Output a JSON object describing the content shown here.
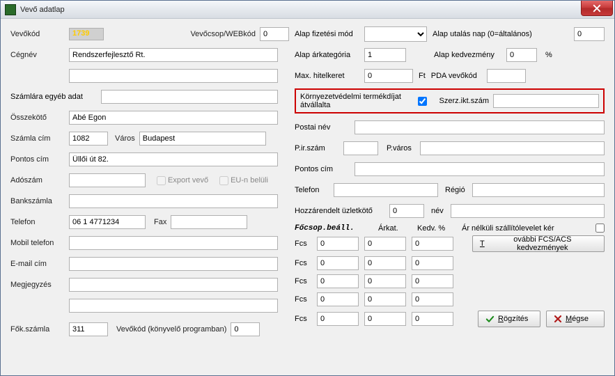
{
  "window": {
    "title": "Vevő adatlap"
  },
  "left": {
    "vevokod_label": "Vevőkód",
    "vevokod_value": "1739",
    "vevocsop_label": "Vevőcsop/WEBkód",
    "vevocsop_value": "0",
    "cegnev_label": "Cégnév",
    "cegnev_value": "Rendszerfejlesztő Rt.",
    "cegnev2_value": "",
    "szamla_egyeb_label": "Számlára egyéb adat",
    "szamla_egyeb_value": "",
    "osszekoto_label": "Összekötő",
    "osszekoto_value": "Abé Egon",
    "szamla_cim_label": "Számla cím",
    "szamla_irsz_value": "1082",
    "varos_label": "Város",
    "varos_value": "Budapest",
    "pontos_cim_label": "Pontos cím",
    "pontos_cim_value": "Üllői út 82.",
    "adoszam_label": "Adószám",
    "adoszam_value": "",
    "export_vevo_label": "Export vevő",
    "eu_beluli_label": "EU-n belüli",
    "bankszamla_label": "Bankszámla",
    "bankszamla_value": "",
    "telefon_label": "Telefon",
    "telefon_value": "06 1 4771234",
    "fax_label": "Fax",
    "fax_value": "",
    "mobil_label": "Mobil telefon",
    "mobil_value": "",
    "email_label": "E-mail cím",
    "email_value": "",
    "megjegyzes_label": "Megjegyzés",
    "megjegyzes1_value": "",
    "megjegyzes2_value": "",
    "fokszamla_label": "Fők.számla",
    "fokszamla_value": "311",
    "vevokod_konyvelo_label": "Vevőkód (könyvelő programban)",
    "vevokod_konyvelo_value": "0"
  },
  "right": {
    "alap_fiz_label": "Alap fizetési mód",
    "alap_utalas_label": "Alap utalás nap (0=általános)",
    "alap_utalas_value": "0",
    "alap_arkat_label": "Alap árkategória",
    "alap_arkat_value": "1",
    "alap_kedv_label": "Alap kedvezmény",
    "alap_kedv_value": "0",
    "percent": "%",
    "max_hitel_label": "Max. hitelkeret",
    "max_hitel_value": "0",
    "ft_label": "Ft",
    "pda_label": "PDA vevőkód",
    "pda_value": "",
    "korny_label": "Környezetvédelmi termékdíjat átvállalta",
    "szerz_label": "Szerz.ikt.szám",
    "szerz_value": "",
    "postai_nev_label": "Postai név",
    "postai_nev_value": "",
    "pirszam_label": "P.ir.szám",
    "pirszam_value": "",
    "pvaros_label": "P.város",
    "pvaros_value": "",
    "p_pontos_cim_label": "Pontos cím",
    "p_pontos_cim_value": "",
    "telefon_label": "Telefon",
    "telefon_value": "",
    "regio_label": "Régió",
    "regio_value": "",
    "hozzarendelt_label": "Hozzárendelt üzletkötő",
    "hozzarendelt_value": "0",
    "nev_label": "név",
    "nev_value": "",
    "focsop_header": "Főcsop.beáll.",
    "arkat_header": "Árkat.",
    "kedv_header": "Kedv. %",
    "arnelkuli_label": "Ár nélküli szállítólevelet kér",
    "fcs": [
      {
        "lbl": "Fcs",
        "a": "0",
        "b": "0",
        "c": "0"
      },
      {
        "lbl": "Fcs",
        "a": "0",
        "b": "0",
        "c": "0"
      },
      {
        "lbl": "Fcs",
        "a": "0",
        "b": "0",
        "c": "0"
      },
      {
        "lbl": "Fcs",
        "a": "0",
        "b": "0",
        "c": "0"
      },
      {
        "lbl": "Fcs",
        "a": "0",
        "b": "0",
        "c": "0"
      }
    ],
    "tovabbi_btn_pre": "T",
    "tovabbi_btn_rest": "ovábbi FCS/ACS kedvezmények"
  },
  "buttons": {
    "rogzites_pre": "R",
    "rogzites_rest": "ögzítés",
    "megse_pre": "M",
    "megse_rest": "égse"
  }
}
